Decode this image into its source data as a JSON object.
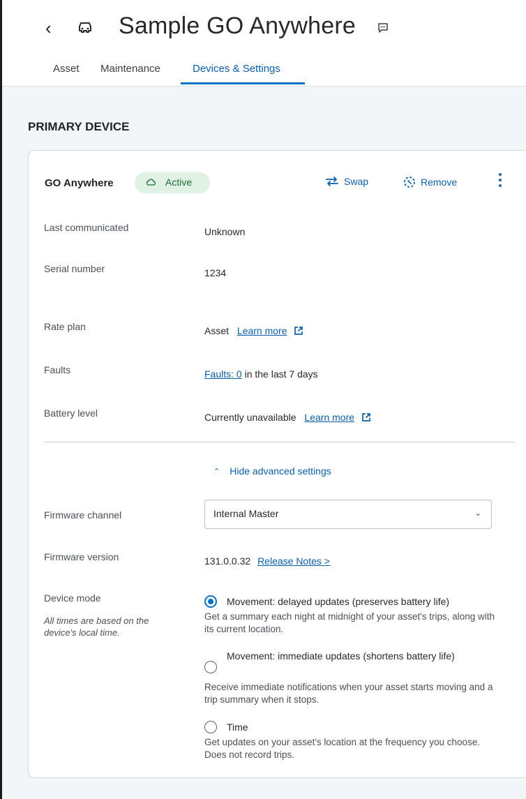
{
  "header": {
    "title": "Sample GO Anywhere",
    "back_glyph": "‹",
    "icons": [
      "chevron-left-icon",
      "car-icon",
      "comment-icon"
    ],
    "tabs": [
      {
        "label": "Asset",
        "active": false
      },
      {
        "label": "Maintenance",
        "active": false
      },
      {
        "label": "Devices & Settings",
        "active": true
      }
    ]
  },
  "section": {
    "title": "PRIMARY DEVICE"
  },
  "device": {
    "name": "GO Anywhere",
    "status": "Active",
    "actions": {
      "swap": "Swap",
      "remove": "Remove"
    },
    "fields": {
      "last_communicated": {
        "label": "Last communicated",
        "value": "Unknown"
      },
      "serial_number": {
        "label": "Serial number",
        "value": "1234"
      },
      "rate_plan": {
        "label": "Rate plan",
        "value": "Asset",
        "link": "Learn more"
      },
      "faults": {
        "label": "Faults",
        "link": "Faults: 0",
        "suffix": " in the last 7 days"
      },
      "battery_level": {
        "label": "Battery level",
        "value": "Currently unavailable",
        "link": "Learn more"
      }
    }
  },
  "advanced": {
    "toggle_label": "Hide advanced settings",
    "firmware_channel": {
      "label": "Firmware channel",
      "selected": "Internal Master"
    },
    "firmware_version": {
      "label": "Firmware version",
      "value": "131.0.0.32",
      "link": "Release Notes >"
    },
    "device_mode": {
      "label": "Device mode",
      "note": "All times are based on the device's local time.",
      "options": [
        {
          "title": "Movement: delayed updates (preserves battery life)",
          "description": "Get a summary each night at midnight of your asset's trips, along with its current location.",
          "checked": true
        },
        {
          "title": "Movement: immediate updates (shortens battery life)",
          "description": "Receive immediate notifications when your asset starts moving and a trip summary when it stops.",
          "checked": false
        },
        {
          "title": "Time",
          "description": "Get updates on your asset's location at the frequency you choose. Does not record trips.",
          "checked": false
        }
      ]
    }
  },
  "colors": {
    "accent": "#0b72c7",
    "link": "#0b5fa8",
    "badge_bg": "#e0f2e4",
    "badge_text": "#1f6b35",
    "page_bg": "#f3f6f8"
  }
}
